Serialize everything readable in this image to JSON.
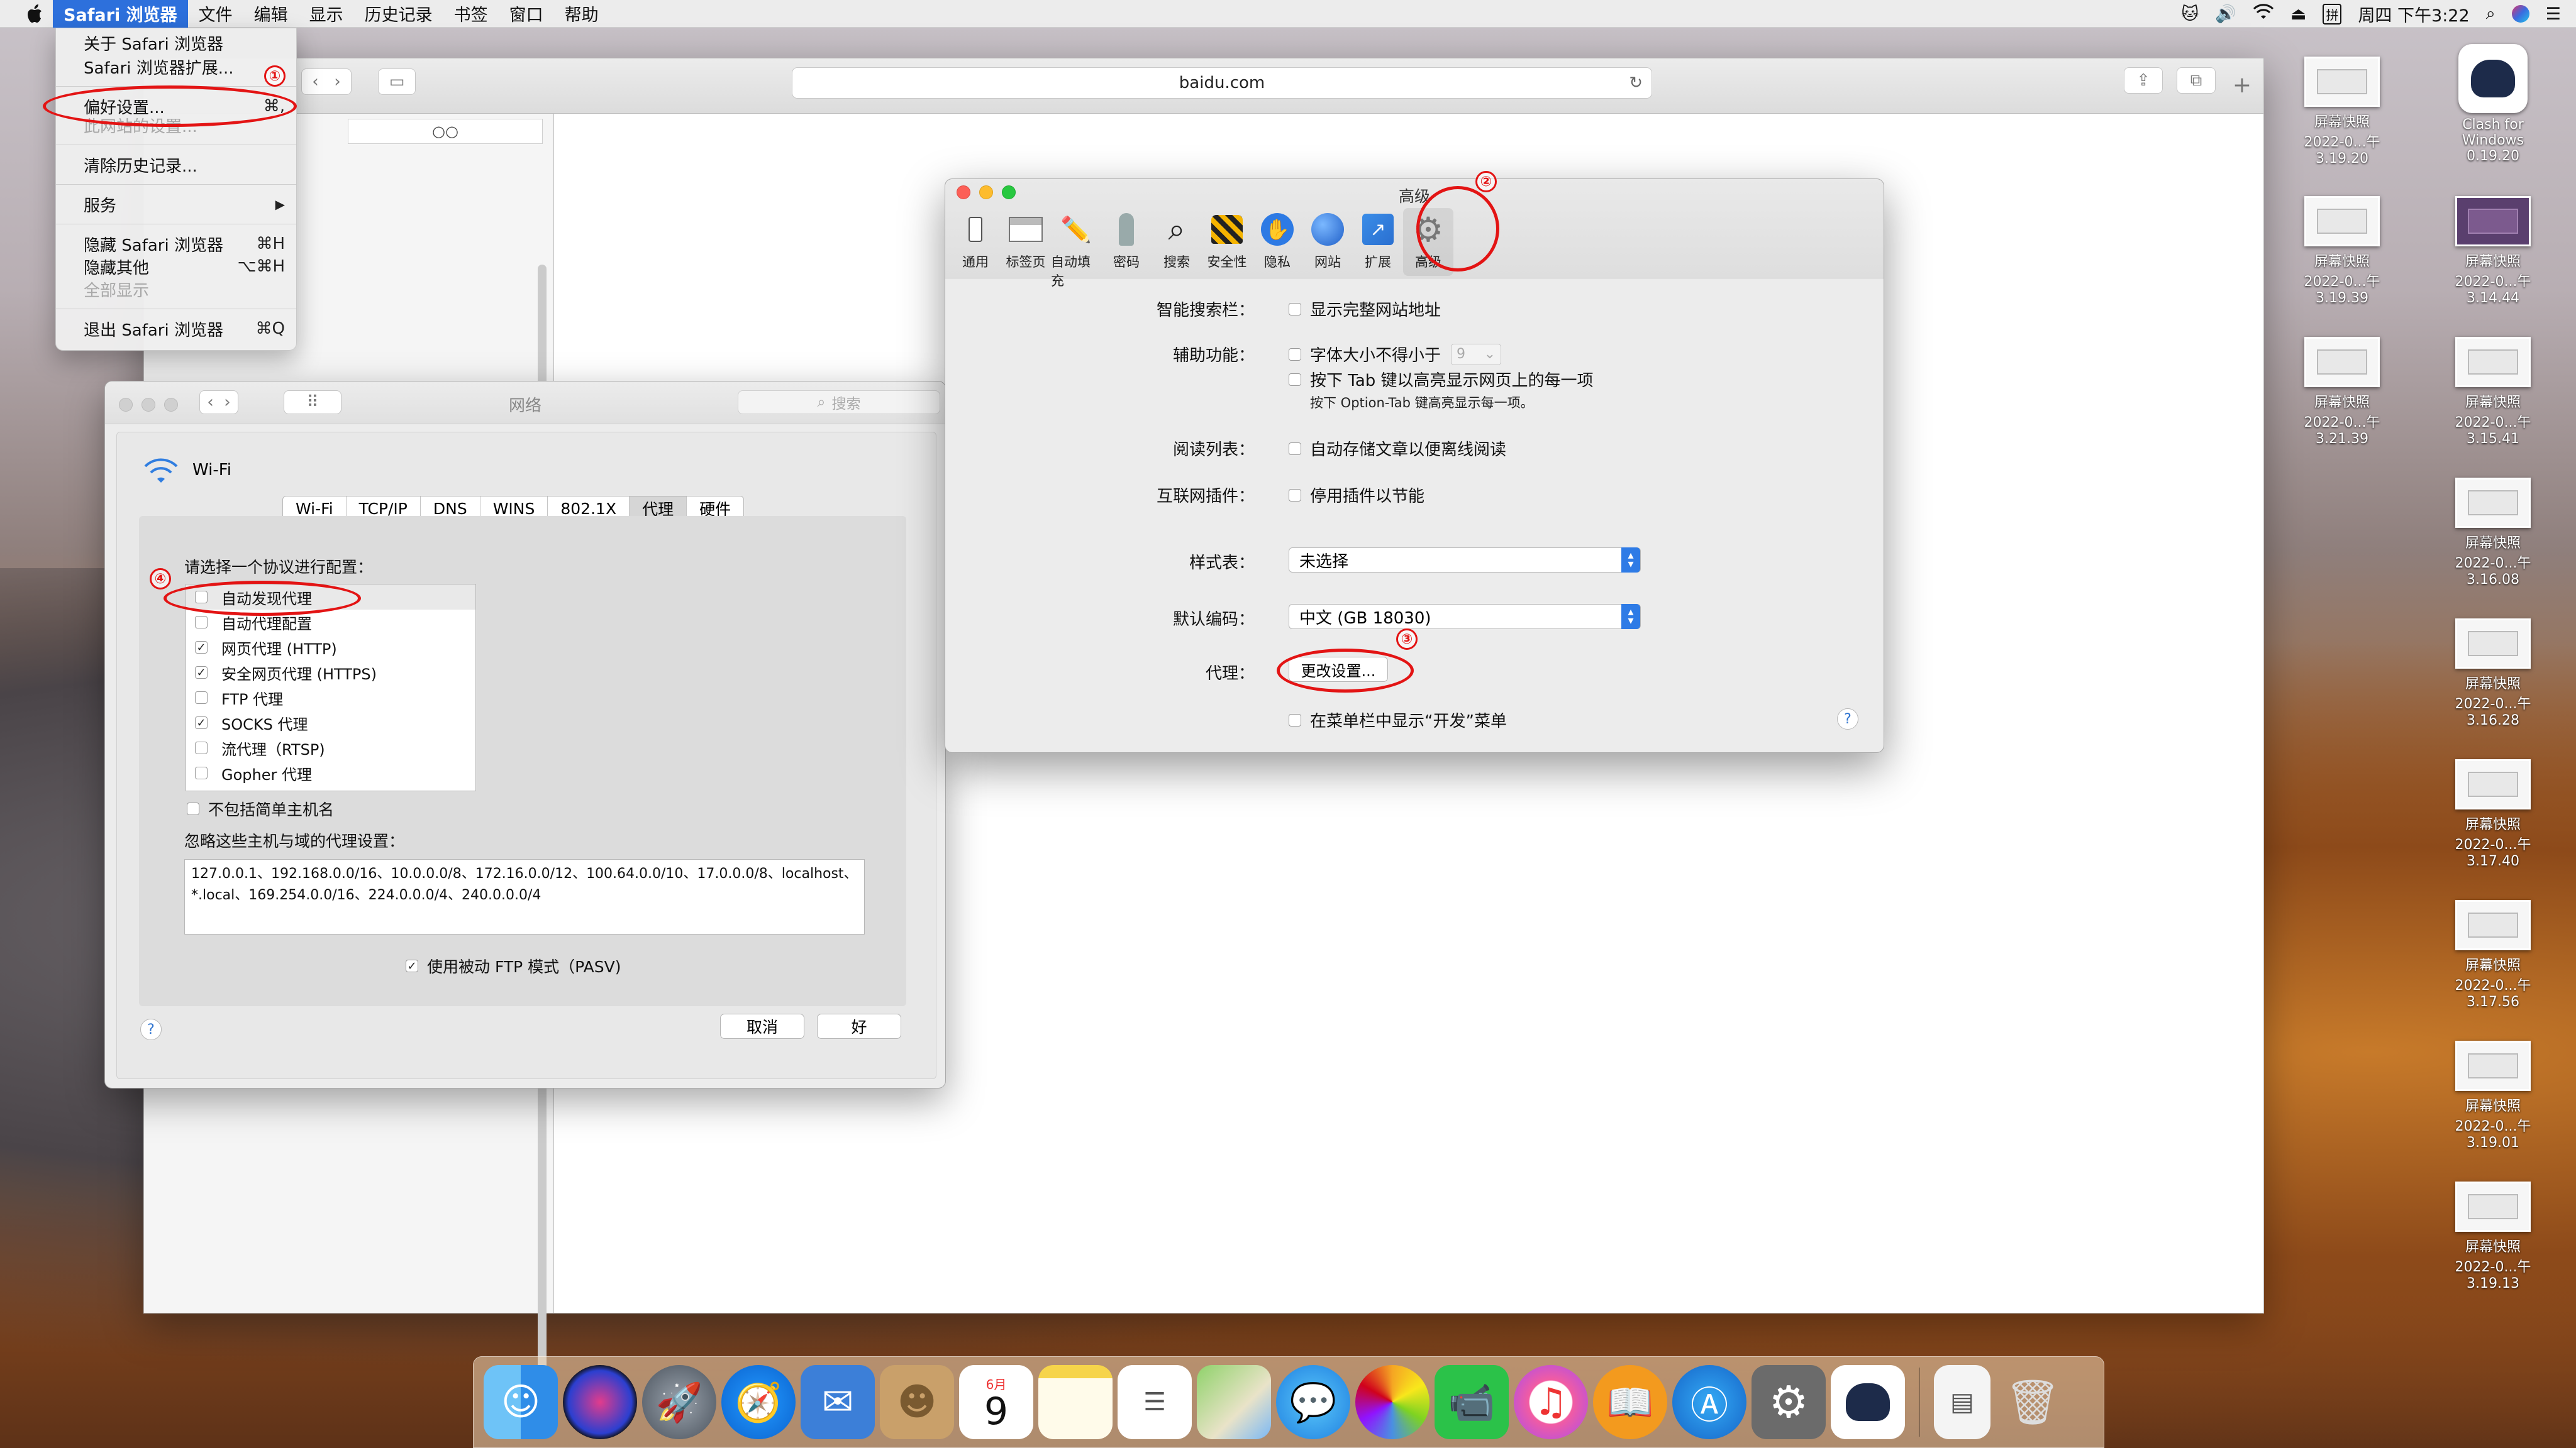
{
  "menubar": {
    "apple": "",
    "app": "Safari 浏览器",
    "items": [
      "文件",
      "编辑",
      "显示",
      "历史记录",
      "书签",
      "窗口",
      "帮助"
    ],
    "clock": "周四 下午3:22"
  },
  "app_menu": {
    "items": [
      {
        "label": "关于 Safari 浏览器",
        "shortcut": ""
      },
      {
        "label": "Safari 浏览器扩展...",
        "shortcut": ""
      },
      {
        "label": "偏好设置...",
        "shortcut": "⌘,"
      },
      {
        "label": "此网站的设置...",
        "shortcut": "",
        "dim": true
      },
      {
        "label": "清除历史记录...",
        "shortcut": ""
      },
      {
        "label": "服务",
        "shortcut": "▶"
      },
      {
        "label": "隐藏 Safari 浏览器",
        "shortcut": "⌘H"
      },
      {
        "label": "隐藏其他",
        "shortcut": "⌥⌘H"
      },
      {
        "label": "全部显示",
        "shortcut": "",
        "dim": true
      },
      {
        "label": "退出 Safari 浏览器",
        "shortcut": "⌘Q"
      }
    ]
  },
  "browser": {
    "url": "baidu.com",
    "reader_glyph": "○○"
  },
  "network": {
    "title": "网络",
    "search_placeholder": "搜索",
    "interface": "Wi-Fi",
    "tabs": [
      "Wi-Fi",
      "TCP/IP",
      "DNS",
      "WINS",
      "802.1X",
      "代理",
      "硬件"
    ],
    "selected_tab": "代理",
    "protocol_prompt": "请选择一个协议进行配置：",
    "protocols": [
      {
        "label": "自动发现代理",
        "checked": false
      },
      {
        "label": "自动代理配置",
        "checked": false
      },
      {
        "label": "网页代理 (HTTP)",
        "checked": true
      },
      {
        "label": "安全网页代理 (HTTPS)",
        "checked": true
      },
      {
        "label": "FTP 代理",
        "checked": false
      },
      {
        "label": "SOCKS 代理",
        "checked": true
      },
      {
        "label": "流代理（RTSP)",
        "checked": false
      },
      {
        "label": "Gopher 代理",
        "checked": false
      }
    ],
    "exclude_simple": "不包括简单主机名",
    "bypass_label": "忽略这些主机与域的代理设置：",
    "bypass_text": "127.0.0.1、192.168.0.0/16、10.0.0.0/8、172.16.0.0/12、100.64.0.0/10、17.0.0.0/8、localhost、*.local、169.254.0.0/16、224.0.0.0/4、240.0.0.0/4",
    "pasv": "使用被动 FTP 模式（PASV)",
    "help": "?",
    "cancel": "取消",
    "ok": "好"
  },
  "advanced": {
    "title": "高级",
    "toolbar": [
      {
        "label": "通用",
        "icon": "switch-icon"
      },
      {
        "label": "标签页",
        "icon": "tabs-icon"
      },
      {
        "label": "自动填充",
        "icon": "pencil-icon"
      },
      {
        "label": "密码",
        "icon": "key-icon"
      },
      {
        "label": "搜索",
        "icon": "magnifier-icon"
      },
      {
        "label": "安全性",
        "icon": "caution-icon"
      },
      {
        "label": "隐私",
        "icon": "hand-icon"
      },
      {
        "label": "网站",
        "icon": "globe-icon"
      },
      {
        "label": "扩展",
        "icon": "puzzle-icon"
      },
      {
        "label": "高级",
        "icon": "gear-icon"
      }
    ],
    "smart_search_label": "智能搜索栏：",
    "smart_search_opt": "显示完整网站地址",
    "accessibility_label": "辅助功能：",
    "font_size_opt": "字体大小不得小于",
    "font_size_value": "9",
    "tab_highlight_opt": "按下 Tab 键以高亮显示网页上的每一项",
    "tab_hint": "按下 Option-Tab 键高亮显示每一项。",
    "reading_list_label": "阅读列表：",
    "reading_list_opt": "自动存储文章以便离线阅读",
    "plugins_label": "互联网插件：",
    "plugins_opt": "停用插件以节能",
    "stylesheet_label": "样式表：",
    "stylesheet_value": "未选择",
    "encoding_label": "默认编码：",
    "encoding_value": "中文 (GB 18030)",
    "proxy_label": "代理：",
    "proxy_button": "更改设置...",
    "develop_opt": "在菜单栏中显示“开发”菜单",
    "help": "?"
  },
  "annotations": [
    "①",
    "②",
    "③",
    "④"
  ],
  "desktop": {
    "icons": [
      {
        "name": "屏幕快照",
        "date": "2022-0...午3.19.20"
      },
      {
        "name": "Clash for Windows",
        "date": "0.19.20"
      },
      {
        "name": "屏幕快照",
        "date": "2022-0...午3.19.39"
      },
      {
        "name": "屏幕快照",
        "date": "2022-0...午3.14.44"
      },
      {
        "name": "屏幕快照",
        "date": "2022-0...午3.21.39"
      },
      {
        "name": "屏幕快照",
        "date": "2022-0...午3.15.41"
      },
      {
        "name": "屏幕快照",
        "date": "2022-0...午3.16.08"
      },
      {
        "name": "屏幕快照",
        "date": "2022-0...午3.16.28"
      },
      {
        "name": "屏幕快照",
        "date": "2022-0...午3.17.40"
      },
      {
        "name": "屏幕快照",
        "date": "2022-0...午3.17.56"
      },
      {
        "name": "屏幕快照",
        "date": "2022-0...午3.19.01"
      },
      {
        "name": "屏幕快照",
        "date": "2022-0...午3.19.13"
      }
    ]
  },
  "dock": {
    "calendar_month": "6月",
    "calendar_day": "9",
    "items": [
      "finder-icon",
      "siri-icon",
      "launchpad-icon",
      "safari-icon",
      "mail-icon",
      "contacts-icon",
      "calendar-icon",
      "notes-icon",
      "reminders-icon",
      "maps-icon",
      "messages-icon",
      "photos-icon",
      "facetime-icon",
      "itunes-icon",
      "ibooks-icon",
      "appstore-icon",
      "system-preferences-icon",
      "clash-icon",
      "document-icon",
      "trash-icon"
    ]
  }
}
